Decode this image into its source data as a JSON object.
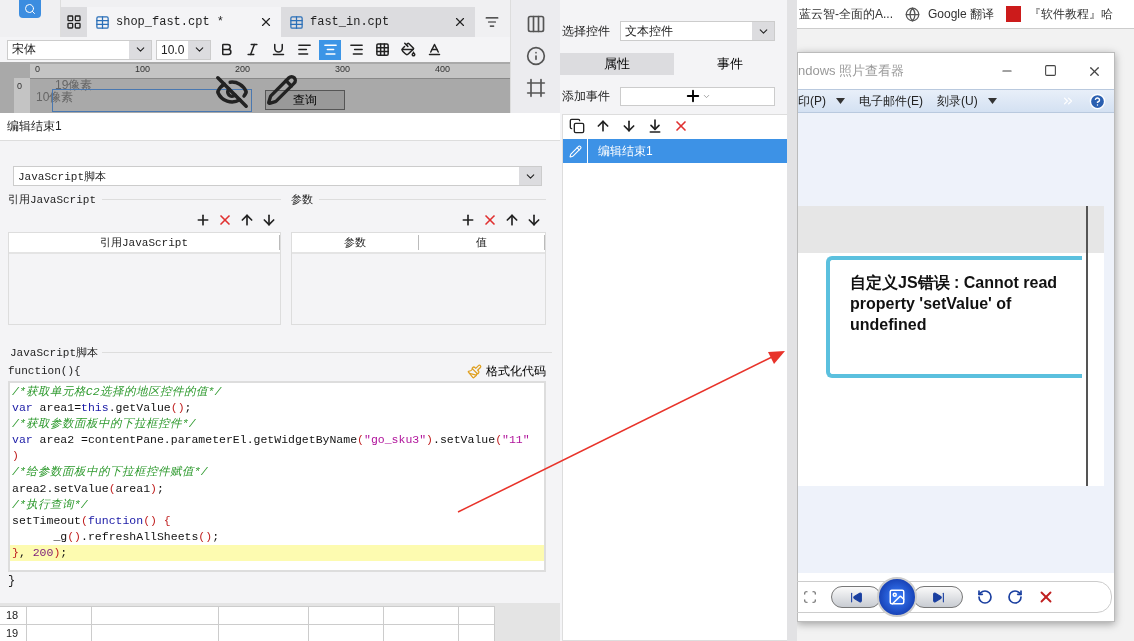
{
  "file_tabs": [
    {
      "label": "shop_fast.cpt *",
      "selected": true
    },
    {
      "label": "fast_in.cpt",
      "selected": false
    }
  ],
  "format_bar": {
    "font": "宋体",
    "size": "10.0",
    "buttons": [
      {
        "kind": "bold",
        "on": false
      },
      {
        "kind": "italic",
        "on": false
      },
      {
        "kind": "underline",
        "on": false
      },
      {
        "kind": "align-left",
        "on": false
      },
      {
        "kind": "align-center",
        "on": true
      },
      {
        "kind": "align-right",
        "on": false
      },
      {
        "kind": "border",
        "on": false
      },
      {
        "kind": "fill",
        "on": false
      },
      {
        "kind": "font-color",
        "on": false
      }
    ]
  },
  "canvas": {
    "ruler_marks": [
      "0",
      "100",
      "200",
      "300",
      "400"
    ],
    "ruler_side": "0",
    "labels": [
      "19像素",
      "10像素"
    ],
    "button": "查询"
  },
  "event_editor": {
    "title": "编辑结束1",
    "script_type": "JavaScript脚本",
    "imports": {
      "title": "引用JavaScript",
      "columns": [
        "引用JavaScript"
      ]
    },
    "params": {
      "title": "参数",
      "columns": [
        "参数",
        "值"
      ]
    },
    "script_title": "JavaScript脚本",
    "header": "function(){",
    "format_button": "格式化代码",
    "footer": "}",
    "code": [
      {
        "highlighted": false,
        "tokens": [
          {
            "kind": "comment",
            "text": "/*获取单元格C2选择的地区控件的值*/"
          }
        ]
      },
      {
        "highlighted": false,
        "tokens": [
          {
            "kind": "keyword",
            "text": "var"
          },
          {
            "kind": "plain",
            "text": " area1="
          },
          {
            "kind": "keyword",
            "text": "this"
          },
          {
            "kind": "plain",
            "text": ".getValue"
          },
          {
            "kind": "paren",
            "text": "()"
          },
          {
            "kind": "plain",
            "text": ";"
          }
        ]
      },
      {
        "highlighted": false,
        "tokens": [
          {
            "kind": "comment",
            "text": "/*获取参数面板中的下拉框控件*/"
          }
        ]
      },
      {
        "highlighted": false,
        "tokens": [
          {
            "kind": "keyword",
            "text": "var"
          },
          {
            "kind": "plain",
            "text": " area2 =contentPane.parameterEl.getWidgetByName"
          },
          {
            "kind": "paren",
            "text": "("
          },
          {
            "kind": "string",
            "text": "\"go_sku3\""
          },
          {
            "kind": "paren",
            "text": ")"
          },
          {
            "kind": "plain",
            "text": ".setValue"
          },
          {
            "kind": "paren",
            "text": "("
          },
          {
            "kind": "string",
            "text": "\"11\""
          }
        ]
      },
      {
        "highlighted": false,
        "tokens": [
          {
            "kind": "paren",
            "text": ")"
          }
        ]
      },
      {
        "highlighted": false,
        "tokens": [
          {
            "kind": "comment",
            "text": "/*给参数面板中的下拉框控件赋值*/"
          }
        ]
      },
      {
        "highlighted": false,
        "tokens": [
          {
            "kind": "plain",
            "text": "area2.setValue"
          },
          {
            "kind": "paren",
            "text": "("
          },
          {
            "kind": "plain",
            "text": "area1"
          },
          {
            "kind": "paren",
            "text": ")"
          },
          {
            "kind": "plain",
            "text": ";"
          }
        ]
      },
      {
        "highlighted": false,
        "tokens": [
          {
            "kind": "comment",
            "text": "/*执行查询*/"
          }
        ]
      },
      {
        "highlighted": false,
        "tokens": [
          {
            "kind": "plain",
            "text": "setTimeout"
          },
          {
            "kind": "paren",
            "text": "("
          },
          {
            "kind": "keyword",
            "text": "function"
          },
          {
            "kind": "paren",
            "text": "() {"
          }
        ]
      },
      {
        "highlighted": false,
        "tokens": [
          {
            "kind": "plain",
            "text": "      _g"
          },
          {
            "kind": "paren",
            "text": "()"
          },
          {
            "kind": "plain",
            "text": ".refreshAllSheets"
          },
          {
            "kind": "paren",
            "text": "()"
          },
          {
            "kind": "plain",
            "text": ";"
          }
        ]
      },
      {
        "highlighted": true,
        "tokens": [
          {
            "kind": "paren",
            "text": "}"
          },
          {
            "kind": "plain",
            "text": ", "
          },
          {
            "kind": "number",
            "text": "200"
          },
          {
            "kind": "paren",
            "text": ")"
          },
          {
            "kind": "plain",
            "text": ";"
          }
        ]
      }
    ]
  },
  "sheet": {
    "rows": [
      "18",
      "19"
    ]
  },
  "widget_settings": {
    "select_label": "选择控件",
    "select_value": "文本控件",
    "tabs": [
      {
        "label": "属性",
        "selected": false
      },
      {
        "label": "事件",
        "selected": true
      }
    ],
    "add_event_label": "添加事件",
    "events": [
      {
        "label": "编辑结束1",
        "selected": true
      }
    ]
  },
  "bookmarks": [
    {
      "label": "蓝云智-全面的A...",
      "kind": "plain"
    },
    {
      "label": "Google 翻译",
      "kind": "globe"
    },
    {
      "label": "『软件教程』哈",
      "kind": "red"
    }
  ],
  "photo_viewer": {
    "title": "ndows 照片查看器",
    "menu": [
      {
        "label": "印(P)",
        "dropdown": true
      },
      {
        "label": "电子邮件(E)",
        "dropdown": false
      },
      {
        "label": "刻录(U)",
        "dropdown": true
      }
    ],
    "error_message": "自定义JS错误 : Cannot read property 'setValue' of undefined"
  }
}
